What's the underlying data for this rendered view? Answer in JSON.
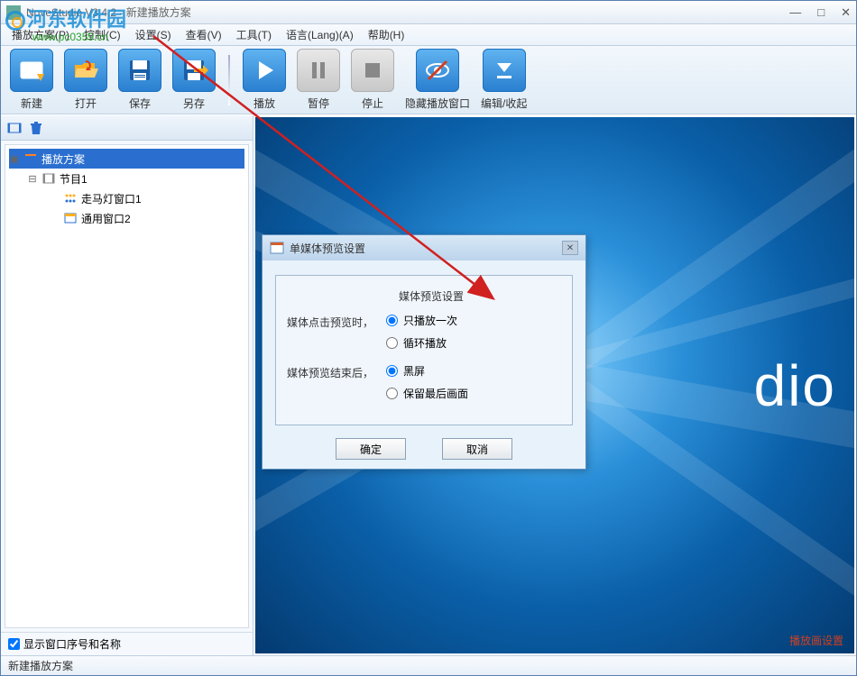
{
  "window": {
    "title": "NoveStudio V3.4.2 - 新建播放方案"
  },
  "watermark": {
    "text": "河东软件园",
    "url": "www.pc0359.cn"
  },
  "menu": [
    "播放方案(P)",
    "控制(C)",
    "设置(S)",
    "查看(V)",
    "工具(T)",
    "语言(Lang)(A)",
    "帮助(H)"
  ],
  "toolbar": [
    {
      "name": "new",
      "label": "新建"
    },
    {
      "name": "open",
      "label": "打开"
    },
    {
      "name": "save",
      "label": "保存"
    },
    {
      "name": "saveas",
      "label": "另存"
    },
    {
      "name": "play",
      "label": "播放"
    },
    {
      "name": "pause",
      "label": "暂停",
      "disabled": true
    },
    {
      "name": "stop",
      "label": "停止",
      "disabled": true
    },
    {
      "name": "hide",
      "label": "隐藏播放窗口"
    },
    {
      "name": "collapse",
      "label": "编辑/收起"
    }
  ],
  "tree": {
    "root": {
      "label": "播放方案"
    },
    "items": [
      {
        "label": "节目1"
      },
      {
        "label": "走马灯窗口1"
      },
      {
        "label": "通用窗口2"
      }
    ]
  },
  "sidebarFooter": {
    "checkbox_label": "显示窗口序号和名称"
  },
  "preview": {
    "brand": "dio",
    "link": "播放画设置"
  },
  "dialog": {
    "title": "单媒体预览设置",
    "legend": "媒体预览设置",
    "group1_label": "媒体点击预览时，",
    "group1_opt1": "只播放一次",
    "group1_opt2": "循环播放",
    "group2_label": "媒体预览结束后，",
    "group2_opt1": "黑屏",
    "group2_opt2": "保留最后画面",
    "ok": "确定",
    "cancel": "取消"
  },
  "status": "新建播放方案"
}
